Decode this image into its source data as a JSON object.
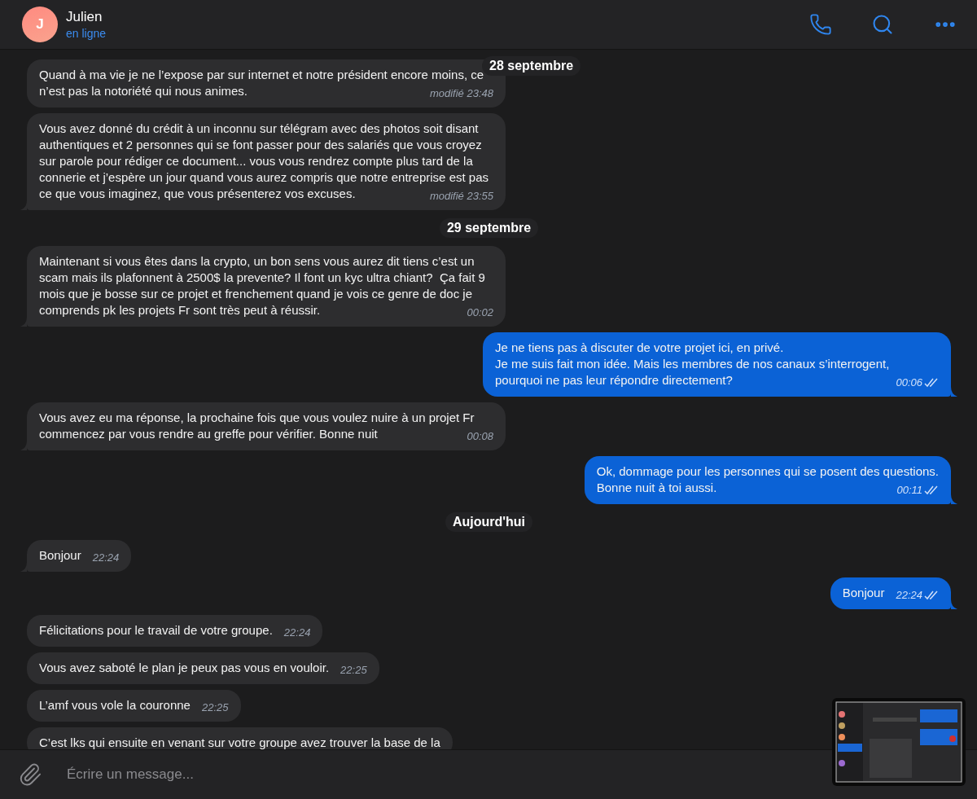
{
  "header": {
    "avatar_letter": "J",
    "name": "Julien",
    "status": "en ligne"
  },
  "messages": [
    {
      "kind": "received",
      "text": "Quand à ma vie je ne l’expose par sur internet et notre président encore moins, ce n’est pas la notoriété qui nous animes.",
      "edited": "modifié",
      "time": "23:48",
      "tail": false
    },
    {
      "kind": "received",
      "text": "Vous avez donné du crédit à un inconnu sur télégram avec des photos soit disant authentiques et 2 personnes qui se font passer pour des salariés que vous croyez sur parole pour rédiger ce document... vous vous rendrez compte plus tard de la connerie et j’espère un jour quand vous aurez compris que notre entreprise est pas ce que vous imaginez, que vous présenterez vos excuses.",
      "edited": "modifié",
      "time": "23:55",
      "tail": true
    },
    {
      "kind": "date",
      "text": "29 septembre"
    },
    {
      "kind": "received",
      "text": "Maintenant si vous êtes dans la crypto, un bon sens vous aurez dit tiens c’est un scam mais ils plafonnent à 2500$ la prevente? Il font un kyc ultra chiant?  Ça fait 9 mois que je bosse sur ce projet et frenchement quand je vois ce genre de doc je comprends pk les projets Fr sont très peut à réussir.",
      "time": "00:02",
      "tail": true
    },
    {
      "kind": "sent",
      "text": "Je ne tiens pas à discuter de votre projet ici, en privé.\nJe me suis fait mon idée. Mais les membres de nos canaux s’interrogent, pourquoi ne pas leur répondre directement?",
      "time": "00:06",
      "read": true,
      "tail": true
    },
    {
      "kind": "received",
      "text": "Vous avez eu ma réponse, la prochaine fois que vous voulez nuire à un projet Fr commencez par vous rendre au greffe pour vérifier. Bonne nuit",
      "time": "00:08",
      "tail": true
    },
    {
      "kind": "sent",
      "text": "Ok, dommage pour les personnes qui se posent des questions.\nBonne nuit à toi aussi.",
      "time": "00:11",
      "read": true,
      "tail": true
    },
    {
      "kind": "date",
      "text": "Aujourd'hui"
    },
    {
      "kind": "received",
      "text": "Bonjour",
      "time": "22:24",
      "tail": true
    },
    {
      "kind": "sent",
      "text": "Bonjour",
      "time": "22:24",
      "read": true,
      "tail": true
    },
    {
      "kind": "received",
      "text": "Félicitations pour le travail de votre groupe.",
      "time": "22:24",
      "tail": false
    },
    {
      "kind": "received",
      "text": "Vous avez saboté le plan je peux pas vous en vouloir.",
      "time": "22:25",
      "tail": false
    },
    {
      "kind": "received",
      "text": "L’amf vous vole la couronne",
      "time": "22:25",
      "tail": false
    },
    {
      "kind": "received",
      "text": "C’est lks qui ensuite en venant sur votre groupe avez trouver la base de la",
      "tail": false
    }
  ],
  "sticky_date": "28 septembre",
  "composer": {
    "placeholder": "Écrire un message..."
  }
}
